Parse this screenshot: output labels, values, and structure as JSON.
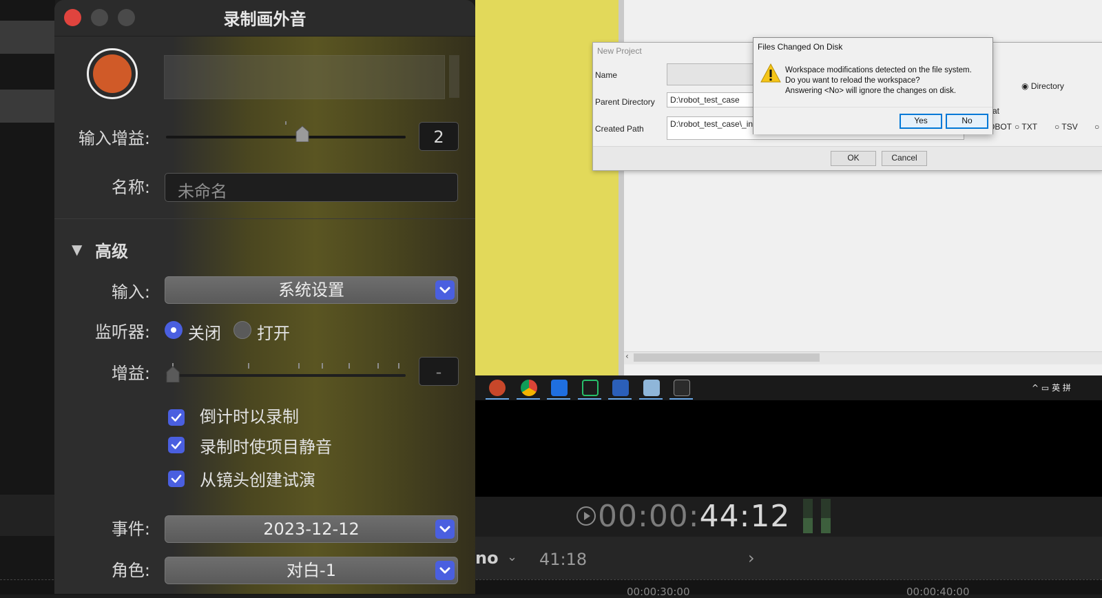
{
  "voiceover": {
    "title": "录制画外音",
    "input_gain_label": "输入增益:",
    "input_gain_value": "2",
    "input_gain_level": 0.57,
    "name_label": "名称:",
    "name_placeholder": "未命名",
    "advanced_label": "高级",
    "input_label": "输入:",
    "input_value": "系统设置",
    "monitor_label": "监听器:",
    "monitor_off": "关闭",
    "monitor_on": "打开",
    "gain_label": "增益:",
    "gain_value": "-",
    "checkbox_countdown": "倒计时以录制",
    "checkbox_mute": "录制时使项目静音",
    "checkbox_audition": "从镜头创建试演",
    "event_label": "事件:",
    "event_value": "2023-12-12",
    "role_label": "角色:",
    "role_value": "对白-1",
    "accent_color": "#4a5fe0",
    "record_color": "#d05a28"
  },
  "new_project": {
    "title": "New Project",
    "name_label": "Name",
    "parent_label": "Parent Directory",
    "parent_value": "D:\\robot_test_case",
    "created_label": "Created Path",
    "created_value": "D:\\robot_test_case\\_ini",
    "type_partial": "e",
    "directory_option": "Directory",
    "format_partial": "at",
    "robot_partial": "OBOT",
    "txt_option": "TXT",
    "tsv_option": "TSV",
    "ok_label": "OK",
    "cancel_label": "Cancel"
  },
  "files_changed": {
    "title": "Files Changed On Disk",
    "line1": "Workspace modifications detected on the file system.",
    "line2": "Do you want to reload the workspace?",
    "line3": "Answering <No> will ignore the changes on disk.",
    "yes_label": "Yes",
    "no_label": "No"
  },
  "viewer": {
    "timecode_dim": "00:00:",
    "timecode_bright": "44:12",
    "project_name": "no",
    "project_duration": "41:18",
    "ruler_tc1": "00:00:30:00",
    "ruler_tc2": "00:00:40:00"
  },
  "tray": {
    "ime_label": "英",
    "ime2_label": "拼"
  }
}
